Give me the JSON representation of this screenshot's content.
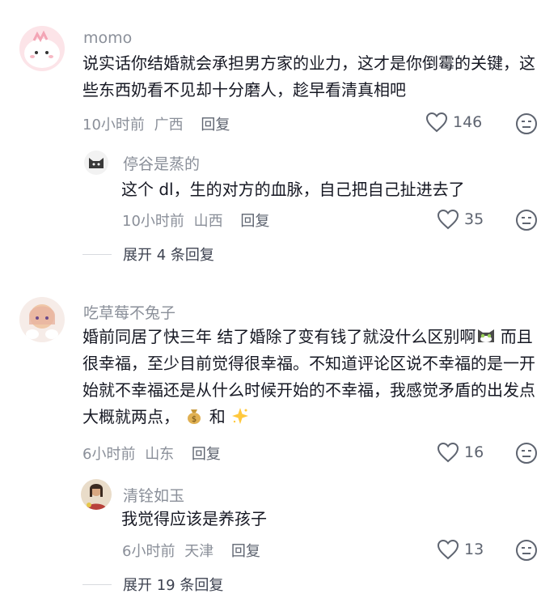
{
  "comments": [
    {
      "username": "momo",
      "text": "说实话你结婚就会承担男方家的业力，这才是你倒霉的关键，这些东西奶看不见却十分磨人，趁早看清真相吧",
      "time": "10小时前",
      "location": "广西",
      "reply_label": "回复",
      "likes": "146",
      "replies": [
        {
          "username": "停谷是蒸的",
          "text": "这个 dl，生的对方的血脉，自己把自己扯进去了",
          "time": "10小时前",
          "location": "山西",
          "reply_label": "回复",
          "likes": "35"
        }
      ],
      "expand_label": "展开 4 条回复"
    },
    {
      "username": "吃草莓不兔子",
      "text_line1": "婚前同居了快三年 结了婚除了变有钱了就没什么区别啊",
      "text_rest": "而且很幸福，至少目前觉得很幸福。不知道评论区说不幸福的是一开始就不幸福还是从什么时候开始的不幸福，我感觉矛盾的出发点大概就两点，",
      "and_text": "和",
      "time": "6小时前",
      "location": "山东",
      "reply_label": "回复",
      "likes": "16",
      "replies": [
        {
          "username": "清铨如玉",
          "text": "我觉得应该是养孩子",
          "time": "6小时前",
          "location": "天津",
          "reply_label": "回复",
          "likes": "13"
        }
      ],
      "expand_label": "展开 19 条回复"
    }
  ],
  "icons": {
    "like": "heart-outline-icon",
    "dislike": "meh-face-icon",
    "emoji_cat": "cat-face-emoji",
    "emoji_money": "money-bag-emoji",
    "emoji_sparkle": "sparkle-star-emoji"
  },
  "colors": {
    "text": "#161823",
    "meta": "#8a8f99",
    "username": "#8a8f99"
  }
}
